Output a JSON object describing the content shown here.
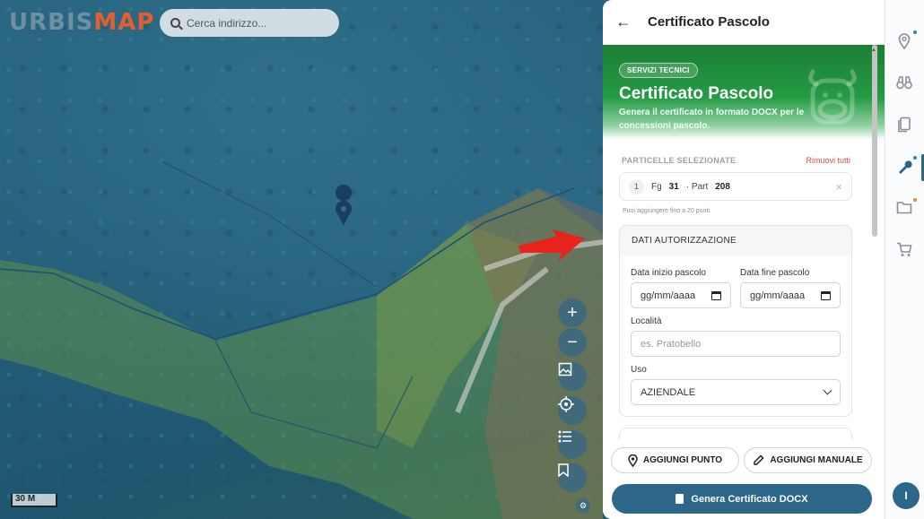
{
  "app": {
    "logo_part1": "URBIS",
    "logo_part2": "MAP"
  },
  "search": {
    "placeholder": "Cerca indirizzo..."
  },
  "map": {
    "scale_label": "30 M",
    "zoom_in": "+",
    "zoom_out": "−"
  },
  "panel": {
    "title": "Certificato Pascolo",
    "badge": "SERVIZI TECNICI",
    "hero_title": "Certificato Pascolo",
    "hero_subtitle": "Genera il certificato in formato DOCX per le concessioni pascolo.",
    "selected_title": "PARTICELLE SELEZIONATE",
    "remove_all": "Rimuovi tutti",
    "parcels": [
      {
        "index": "1",
        "fg_label": "Fg",
        "fg": "31",
        "part_label": "· Part",
        "part": "208"
      }
    ],
    "hint": "Puoi aggiungere fino a 20 punti.",
    "auth_card": {
      "title": "DATI AUTORIZZAZIONE",
      "start_label": "Data inizio pascolo",
      "start_value": "gg/mm/aaaa",
      "end_label": "Data fine pascolo",
      "end_value": "gg/mm/aaaa",
      "locality_label": "Località",
      "locality_placeholder": "es. Pratobello",
      "use_label": "Uso",
      "use_value": "AZIENDALE"
    },
    "buttons": {
      "add_point": "AGGIUNGI PUNTO",
      "add_manual": "AGGIUNGI MANUALE",
      "generate": "Genera Certificato DOCX"
    }
  },
  "rail": {
    "avatar_initial": "I",
    "accent_blue": "#2c6689",
    "dot_blue": "#2f7fd0",
    "dot_orange": "#e38a2f"
  }
}
